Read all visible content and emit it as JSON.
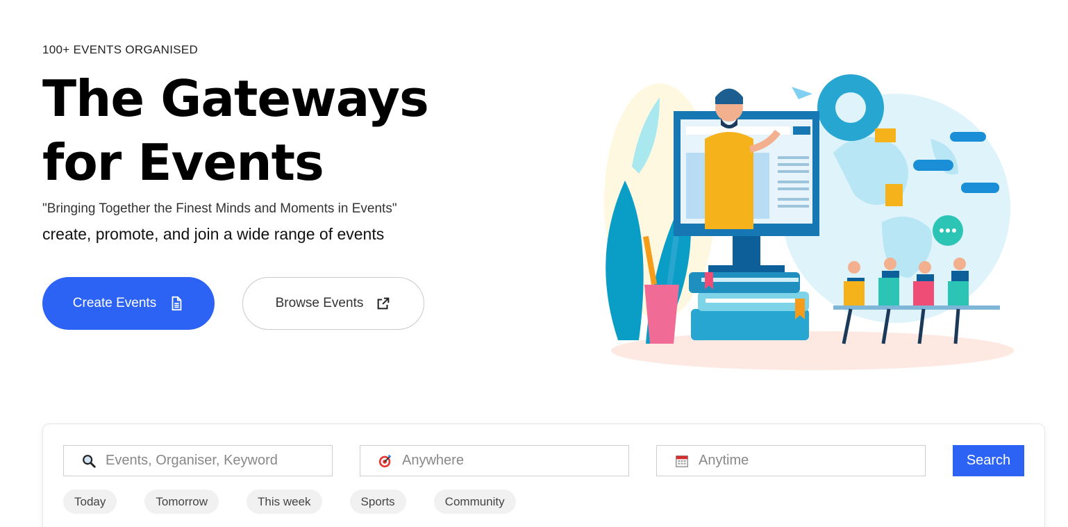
{
  "hero": {
    "eyebrow": "100+ EVENTS ORGANISED",
    "title_line1": "The Gateways",
    "title_line2": "for Events",
    "quote": "\"Bringing Together the Finest Minds and Moments in Events\"",
    "tagline": "create, promote, and join a wide range of events",
    "create_label": "Create Events",
    "browse_label": "Browse Events",
    "create_icon": "document-icon",
    "browse_icon": "external-link-icon"
  },
  "search": {
    "keyword_placeholder": "Events, Organiser, Keyword",
    "location_placeholder": "Anywhere",
    "date_placeholder": "Anytime",
    "button_label": "Search",
    "keyword_icon": "magnifier-icon",
    "location_icon": "target-icon",
    "date_icon": "calendar-icon"
  },
  "chips": [
    "Today",
    "Tomorrow",
    "This week",
    "Sports",
    "Community"
  ],
  "colors": {
    "accent": "#2c63f5"
  }
}
